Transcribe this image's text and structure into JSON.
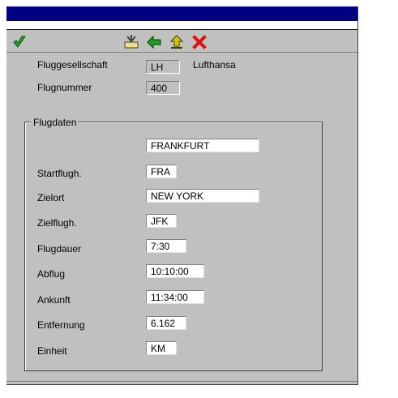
{
  "toolbar": {
    "icons": [
      "check-icon",
      "save-icon",
      "back-icon",
      "exit-icon",
      "cancel-icon"
    ],
    "colors": {
      "check": "#2e9c2e",
      "arrow": "#20a020",
      "exit": "#e0c000",
      "cancel": "#e01010"
    }
  },
  "header": {
    "airline_label": "Fluggesellschaft",
    "airline_code": "LH",
    "airline_name": "Lufthansa",
    "flight_label": "Flugnummer",
    "flight_number": "400"
  },
  "flight_data": {
    "title": "Flugdaten",
    "departure_city": "FRANKFURT",
    "departure_airport_label": "Startflugh.",
    "departure_airport": "FRA",
    "destination_label": "Zielort",
    "destination": "NEW YORK",
    "arrival_airport_label": "Zielflugh.",
    "arrival_airport": "JFK",
    "duration_label": "Flugdauer",
    "duration": "7:30",
    "departure_time_label": "Abflug",
    "departure_time": "10:10:00",
    "arrival_time_label": "Ankunft",
    "arrival_time": "11:34:00",
    "distance_label": "Entfernung",
    "distance": "6.162",
    "unit_label": "Einheit",
    "unit": "KM"
  }
}
